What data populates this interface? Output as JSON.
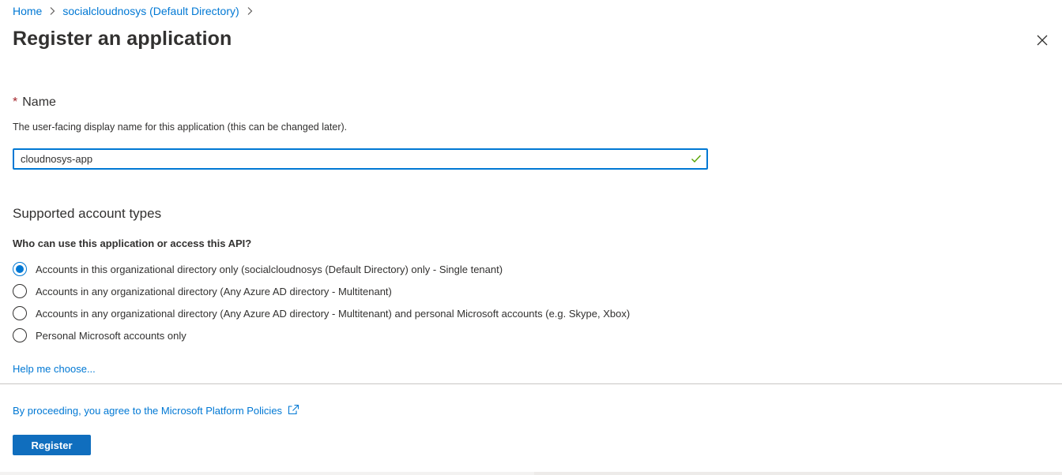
{
  "breadcrumb": {
    "items": [
      {
        "label": "Home"
      },
      {
        "label": "socialcloudnosys (Default Directory)"
      }
    ]
  },
  "page": {
    "title": "Register an application",
    "close_icon": "close-icon"
  },
  "name_field": {
    "required_marker": "*",
    "label": "Name",
    "description": "The user-facing display name for this application (this can be changed later).",
    "value": "cloudnosys-app",
    "valid_icon": "checkmark-icon",
    "valid_color": "#57a300"
  },
  "account_types": {
    "title": "Supported account types",
    "question": "Who can use this application or access this API?",
    "options": [
      {
        "label": "Accounts in this organizational directory only (socialcloudnosys (Default Directory) only - Single tenant)",
        "selected": true
      },
      {
        "label": "Accounts in any organizational directory (Any Azure AD directory - Multitenant)",
        "selected": false
      },
      {
        "label": "Accounts in any organizational directory (Any Azure AD directory - Multitenant) and personal Microsoft accounts (e.g. Skype, Xbox)",
        "selected": false
      },
      {
        "label": "Personal Microsoft accounts only",
        "selected": false
      }
    ],
    "help_link": "Help me choose..."
  },
  "footer": {
    "policy_text": "By proceeding, you agree to the Microsoft Platform Policies",
    "policy_icon": "external-link-icon",
    "register_label": "Register"
  },
  "colors": {
    "accent": "#0078d4",
    "button": "#106ebe",
    "required": "#a4262c",
    "text": "#323130"
  }
}
